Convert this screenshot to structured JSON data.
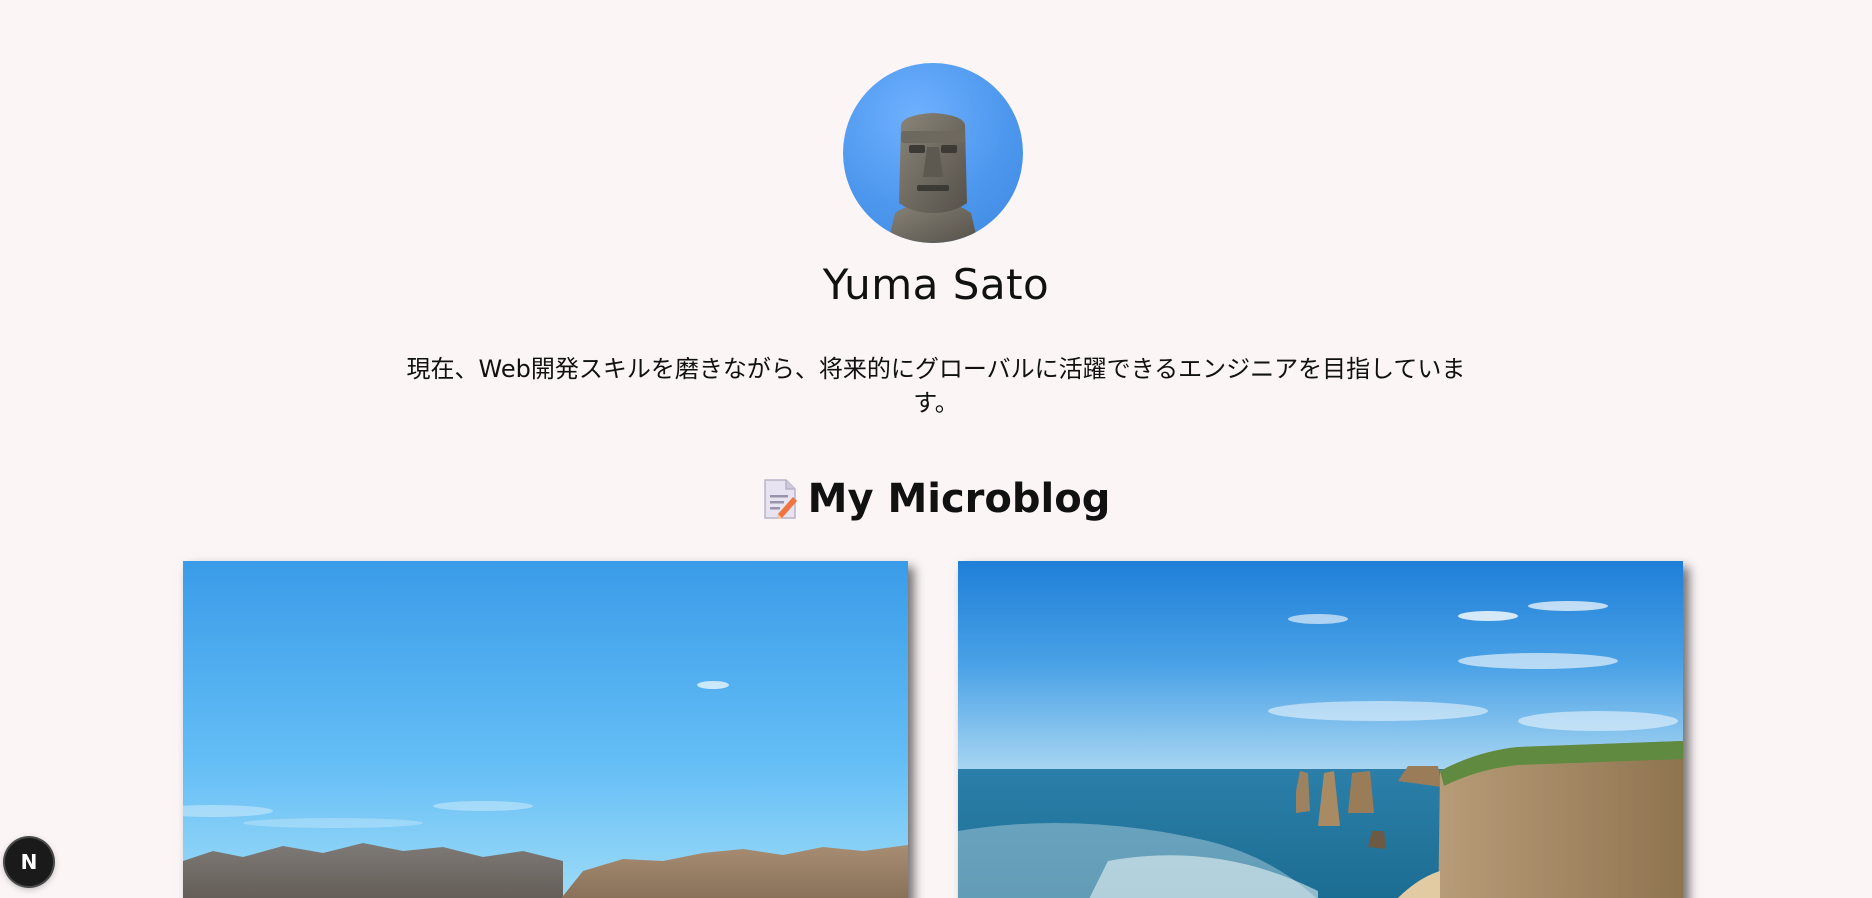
{
  "profile": {
    "name": "Yuma Sato",
    "bio": "現在、Web開発スキルを磨きながら、将来的にグローバルに活躍できるエンジニアを目指しています。",
    "avatar_icon": "moai-avatar"
  },
  "microblog": {
    "title": "My Microblog",
    "title_icon": "memo-icon",
    "posts": [
      {
        "image": "mountain-sky-photo"
      },
      {
        "image": "coastal-cliffs-photo"
      }
    ]
  },
  "dev_badge": {
    "label": "N",
    "icon": "nextjs-icon"
  },
  "colors": {
    "background": "#fbf5f6",
    "text": "#111111",
    "badge_bg": "#1a1a1a"
  }
}
